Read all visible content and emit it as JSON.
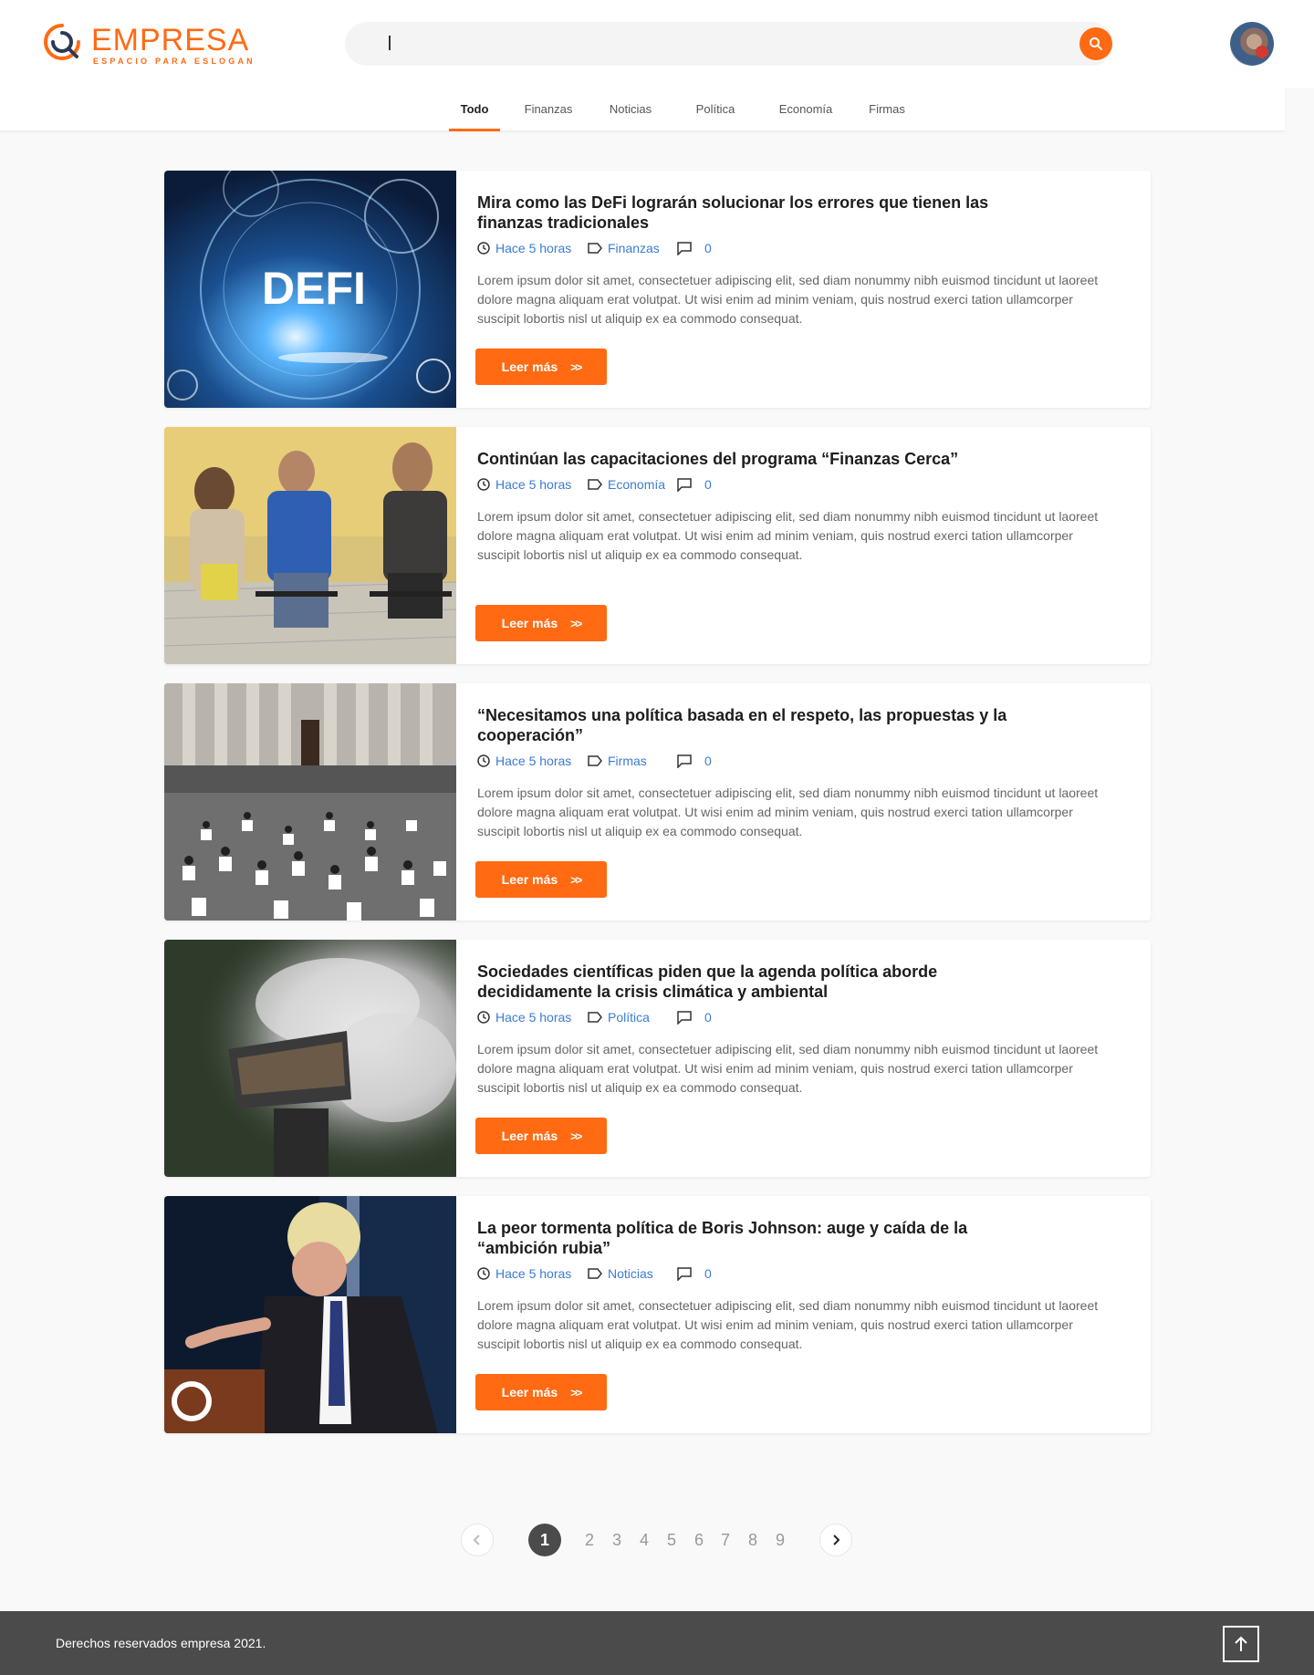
{
  "brand": {
    "name": "EMPRESA",
    "slogan": "ESPACIO PARA ESLOGAN",
    "accent_color": "#ff6a13"
  },
  "search": {
    "value": "",
    "button_icon": "search-icon"
  },
  "user": {
    "avatar_icon": "user-avatar"
  },
  "tabs": [
    {
      "label": "Todo",
      "active": true
    },
    {
      "label": "Finanzas",
      "active": false
    },
    {
      "label": "Noticias",
      "active": false
    },
    {
      "label": "Política",
      "active": false
    },
    {
      "label": "Economía",
      "active": false
    },
    {
      "label": "Firmas",
      "active": false
    }
  ],
  "articles": [
    {
      "title": "Mira como las DeFi lograrán solucionar los errores que tienen las finanzas tradicionales",
      "time": "Hace 5 horas",
      "category": "Finanzas",
      "comments": "0",
      "description": "Lorem ipsum dolor sit amet, consectetuer adipiscing elit, sed diam nonummy nibh euismod tincidunt ut laoreet dolore magna aliquam erat volutpat. Ut wisi enim ad minim veniam, quis nostrud exerci tation ullamcorper suscipit lobortis nisl ut aliquip ex ea commodo consequat.",
      "button": "Leer más",
      "image_text": "DEFI"
    },
    {
      "title": "Continúan las capacitaciones del programa “Finanzas Cerca”",
      "time": "Hace 5 horas",
      "category": "Economía",
      "comments": "0",
      "description": "Lorem ipsum dolor sit amet, consectetuer adipiscing elit, sed diam nonummy nibh euismod tincidunt ut laoreet dolore magna aliquam erat volutpat. Ut wisi enim ad minim veniam, quis nostrud exerci tation ullamcorper suscipit lobortis nisl ut aliquip ex ea commodo consequat.",
      "button": "Leer más"
    },
    {
      "title": "“Necesitamos una política basada en el respeto, las propuestas y la cooperación”",
      "time": "Hace 5 horas",
      "category": "Firmas",
      "comments": "0",
      "description": "Lorem ipsum dolor sit amet, consectetuer adipiscing elit, sed diam nonummy nibh euismod tincidunt ut laoreet dolore magna aliquam erat volutpat. Ut wisi enim ad minim veniam, quis nostrud exerci tation ullamcorper suscipit lobortis nisl ut aliquip ex ea commodo consequat.",
      "button": "Leer más"
    },
    {
      "title": "Sociedades científicas piden que la agenda política aborde decididamente la crisis climática y ambiental",
      "time": "Hace 5 horas",
      "category": "Política",
      "comments": "0",
      "description": "Lorem ipsum dolor sit amet, consectetuer adipiscing elit, sed diam nonummy nibh euismod tincidunt ut laoreet dolore magna aliquam erat volutpat. Ut wisi enim ad minim veniam, quis nostrud exerci tation ullamcorper suscipit lobortis nisl ut aliquip ex ea commodo consequat.",
      "button": "Leer más"
    },
    {
      "title": "La peor tormenta política de Boris Johnson: auge y caída de la “ambición rubia”",
      "time": "Hace 5 horas",
      "category": "Noticias",
      "comments": "0",
      "description": "Lorem ipsum dolor sit amet, consectetuer adipiscing elit, sed diam nonummy nibh euismod tincidunt ut laoreet dolore magna aliquam erat volutpat. Ut wisi enim ad minim veniam, quis nostrud exerci tation ullamcorper suscipit lobortis nisl ut aliquip ex ea commodo consequat.",
      "button": "Leer más"
    }
  ],
  "pagination": {
    "pages": [
      "1",
      "2",
      "3",
      "4",
      "5",
      "6",
      "7",
      "8",
      "9"
    ],
    "current": "1",
    "prev_icon": "chevron-left-icon",
    "next_icon": "chevron-right-icon"
  },
  "footer": {
    "copyright": "Derechos reservados empresa 2021.",
    "to_top_icon": "arrow-up-icon"
  }
}
